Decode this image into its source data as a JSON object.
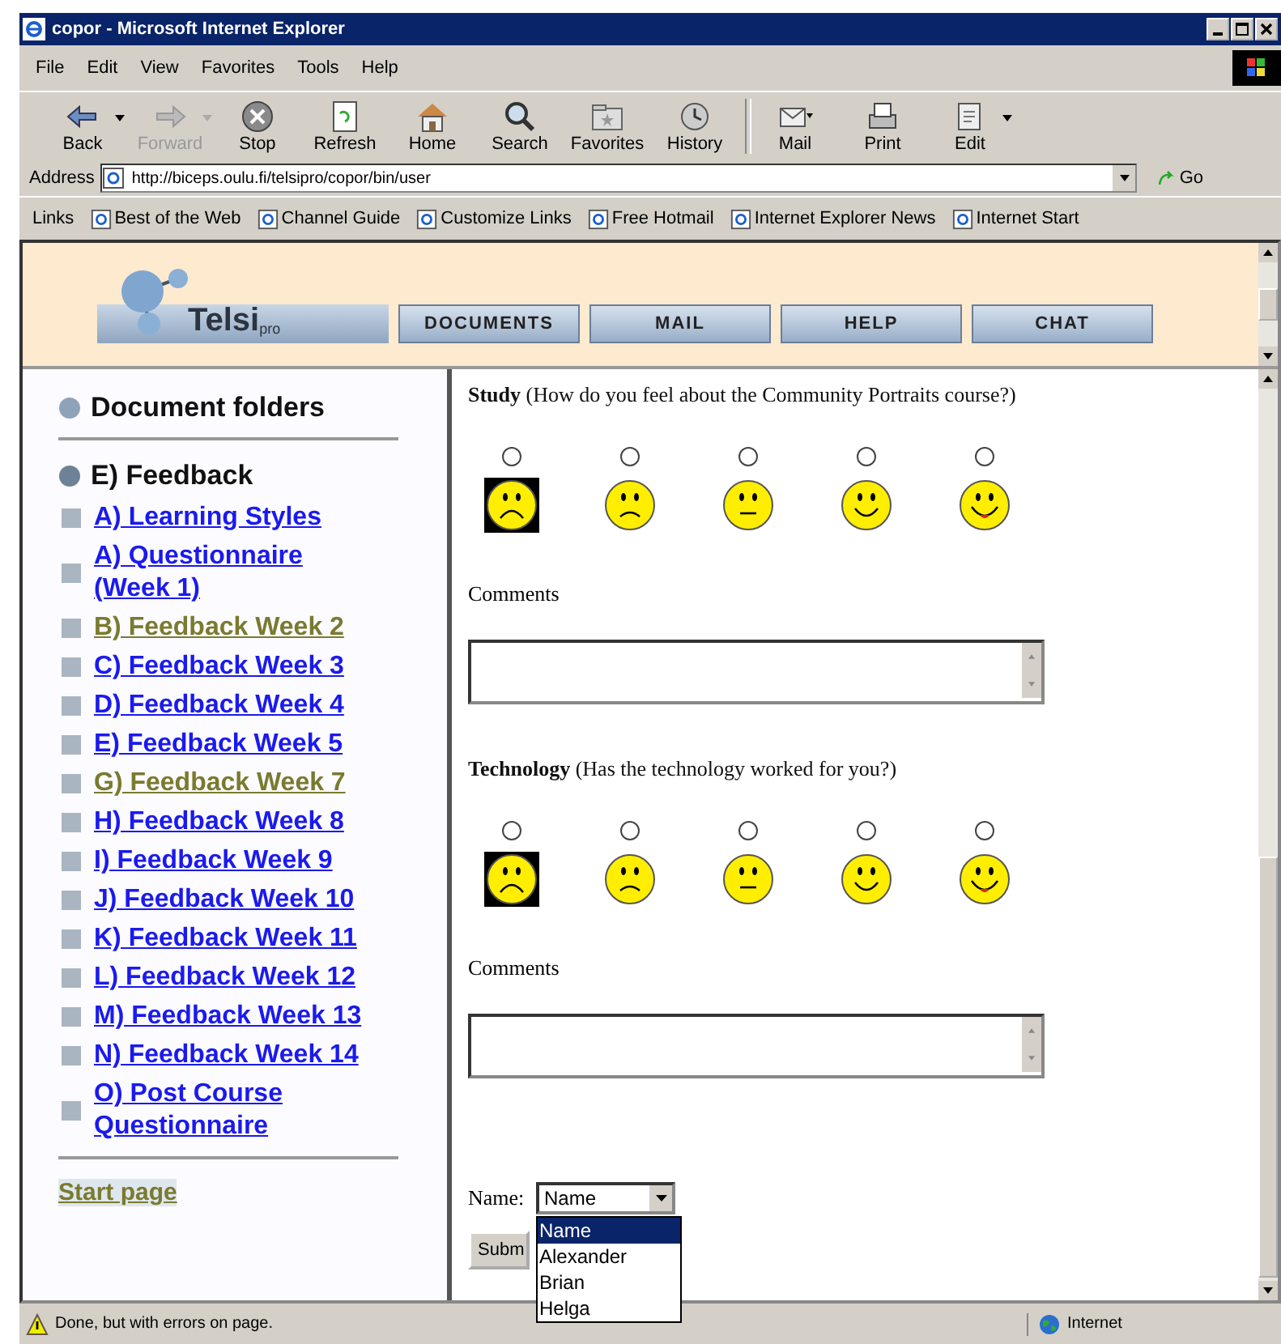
{
  "window": {
    "title": "copor - Microsoft Internet Explorer"
  },
  "menu": [
    "File",
    "Edit",
    "View",
    "Favorites",
    "Tools",
    "Help"
  ],
  "toolbar": [
    {
      "label": "Back",
      "kind": "back",
      "disabled": false,
      "dropdown": true
    },
    {
      "label": "Forward",
      "kind": "forward",
      "disabled": true,
      "dropdown": true
    },
    {
      "label": "Stop",
      "kind": "stop",
      "disabled": false,
      "dropdown": false
    },
    {
      "label": "Refresh",
      "kind": "refresh",
      "disabled": false,
      "dropdown": false
    },
    {
      "label": "Home",
      "kind": "home",
      "disabled": false,
      "dropdown": false
    },
    {
      "label": "Search",
      "kind": "search",
      "disabled": false,
      "dropdown": false
    },
    {
      "label": "Favorites",
      "kind": "favorites",
      "disabled": false,
      "dropdown": false
    },
    {
      "label": "History",
      "kind": "history",
      "disabled": false,
      "dropdown": false
    },
    {
      "label": "Mail",
      "kind": "mail",
      "disabled": false,
      "dropdown": false
    },
    {
      "label": "Print",
      "kind": "print",
      "disabled": false,
      "dropdown": false
    },
    {
      "label": "Edit",
      "kind": "edit",
      "disabled": false,
      "dropdown": true
    }
  ],
  "address": {
    "label": "Address",
    "value": "http://biceps.oulu.fi/telsipro/copor/bin/user",
    "go": "Go"
  },
  "links": {
    "label": "Links",
    "items": [
      "Best of the Web",
      "Channel Guide",
      "Customize Links",
      "Free Hotmail",
      "Internet Explorer News",
      "Internet Start"
    ]
  },
  "banner": {
    "logo": "Telsi",
    "logo_suffix": "pro",
    "buttons": [
      "DOCUMENTS",
      "MAIL",
      "HELP",
      "CHAT"
    ]
  },
  "sidebar": {
    "title": "Document folders",
    "folder": "E) Feedback",
    "items": [
      {
        "label": "A) Learning Styles",
        "visited": false
      },
      {
        "label": "A) Questionnaire (Week 1)",
        "visited": false
      },
      {
        "label": "B) Feedback Week 2",
        "visited": true
      },
      {
        "label": "C) Feedback Week 3",
        "visited": false
      },
      {
        "label": "D) Feedback Week 4",
        "visited": false
      },
      {
        "label": "E) Feedback Week 5",
        "visited": false
      },
      {
        "label": "G) Feedback Week 7",
        "visited": true
      },
      {
        "label": "H) Feedback Week 8",
        "visited": false
      },
      {
        "label": "I) Feedback Week 9",
        "visited": false
      },
      {
        "label": "J) Feedback Week 10",
        "visited": false
      },
      {
        "label": "K) Feedback Week 11",
        "visited": false
      },
      {
        "label": "L) Feedback Week 12",
        "visited": false
      },
      {
        "label": "M) Feedback Week 13",
        "visited": false
      },
      {
        "label": "N) Feedback Week 14",
        "visited": false
      },
      {
        "label": "O) Post Course Questionnaire",
        "visited": false
      }
    ],
    "start_page": {
      "label": "Start page",
      "visited": true
    }
  },
  "questions": [
    {
      "text": "**Study** (How do you feel about the Community Portraits course?)",
      "comments_label": "Comments",
      "options": [
        {
          "kind": "very-sad",
          "checked": false,
          "selected": true
        },
        {
          "kind": "sad",
          "checked": false,
          "selected": false
        },
        {
          "kind": "neutral",
          "checked": false,
          "selected": false
        },
        {
          "kind": "happy",
          "checked": false,
          "selected": false
        },
        {
          "kind": "very-happy",
          "checked": false,
          "selected": false
        }
      ]
    },
    {
      "text": "**Technology** (Has the technology worked for you?)",
      "comments_label": "Comments",
      "options": [
        {
          "kind": "very-sad",
          "checked": false,
          "selected": true
        },
        {
          "kind": "sad",
          "checked": false,
          "selected": false
        },
        {
          "kind": "neutral",
          "checked": false,
          "selected": false
        },
        {
          "kind": "happy",
          "checked": false,
          "selected": false
        },
        {
          "kind": "very-happy",
          "checked": false,
          "selected": false
        }
      ]
    }
  ],
  "name_field": {
    "label": "Name:",
    "value": "Name",
    "options": [
      {
        "label": "Name",
        "selected": true
      },
      {
        "label": "Alexander",
        "selected": false
      },
      {
        "label": "Brian",
        "selected": false
      },
      {
        "label": "Helga",
        "selected": false
      }
    ]
  },
  "submit": "Subm",
  "status_bar": {
    "text": "Done, but with errors on page.",
    "zone": "Internet"
  }
}
